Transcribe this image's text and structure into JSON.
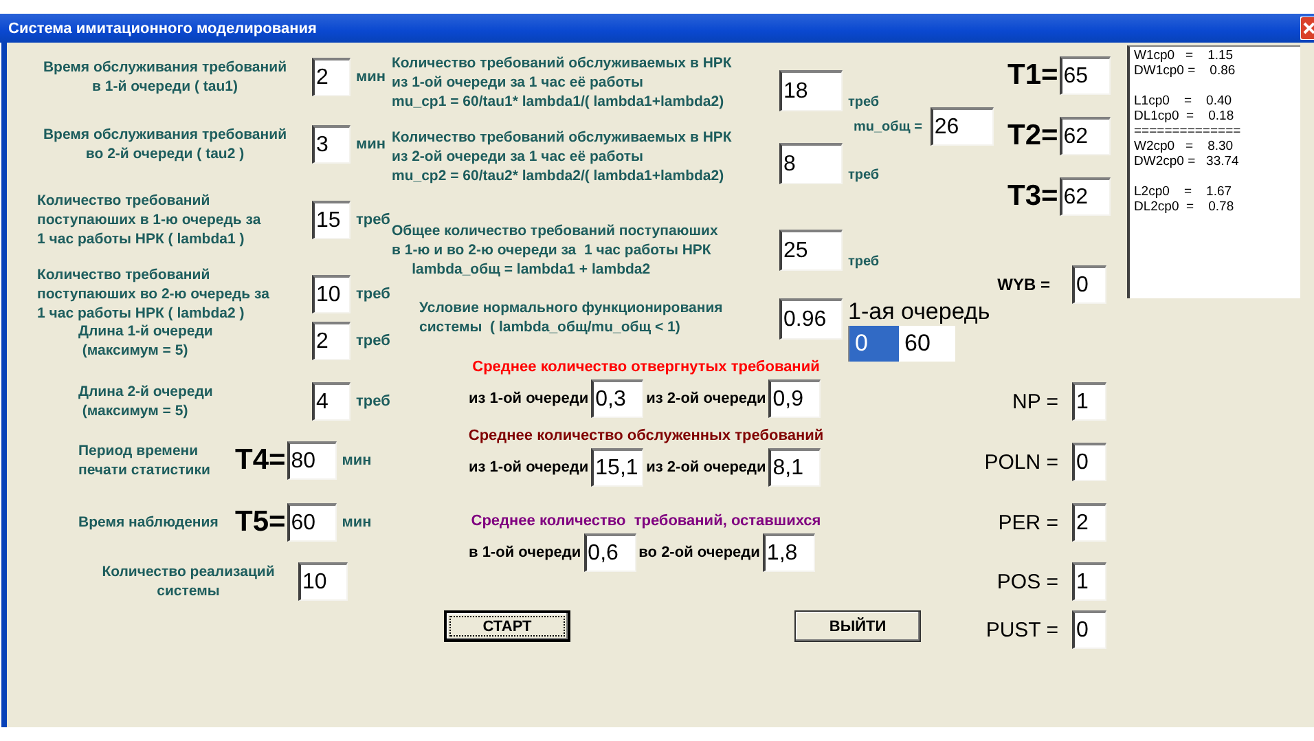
{
  "window": {
    "title": "Система имитационного моделирования"
  },
  "inputs": [
    {
      "label": "Время обслуживания требований\nв 1-й очереди ( tau1)",
      "value": "2",
      "unit": "мин"
    },
    {
      "label": "Время обслуживания требований\nво 2-й очереди ( tau2 )",
      "value": "3",
      "unit": "мин"
    },
    {
      "label": "Количество требований\nпоступаюших в 1-ю очередь за\n1 час работы НРК ( lambda1 )",
      "value": "15",
      "unit": "треб"
    },
    {
      "label": "Количество требований\nпоступаюших во 2-ю очередь за\n1 час работы НРК ( lambda2 )",
      "value": "10",
      "unit": "треб"
    },
    {
      "label": "Длина 1-й очереди\n (максимум = 5)",
      "value": "2",
      "unit": "треб"
    },
    {
      "label": "Длина 2-й очереди\n (максимум = 5)",
      "value": "4",
      "unit": "треб"
    },
    {
      "label": "Период времени\nпечати статистики",
      "prefix": "T4=",
      "value": "80",
      "unit": "мин"
    },
    {
      "label": "Время наблюдения",
      "prefix": "T5=",
      "value": "60",
      "unit": "мин"
    },
    {
      "label": "Количество реализаций\nсистемы",
      "value": "10"
    }
  ],
  "computed": [
    {
      "label": "Количество требований обслуживаемых в НРК\nиз 1-ой очереди за 1 час её работы\nmu_cp1 = 60/tau1* lambda1/( lambda1+lambda2)",
      "value": "18",
      "unit": "треб"
    },
    {
      "label": "Количество требований обслуживаемых в НРК\nиз 2-ой очереди за 1 час её работы\nmu_cp2 = 60/tau2* lambda2/( lambda1+lambda2)",
      "value": "8",
      "unit": "треб"
    },
    {
      "label": "Общее количество требований поступаюших\nв 1-ю и во 2-ю очереди за  1 час работы НРК\n     lambda_общ = lambda1 + lambda2",
      "value": "25",
      "unit": "треб"
    },
    {
      "label": "Условие нормального функционирования\nсистемы  ( lambda_общ/mu_общ < 1)",
      "value": "0.96"
    }
  ],
  "mu_total": {
    "label": "mu_общ =",
    "value": "26"
  },
  "t_fields": [
    {
      "label": "T1=",
      "value": "65"
    },
    {
      "label": "T2=",
      "value": "62"
    },
    {
      "label": "T3=",
      "value": "62"
    }
  ],
  "queue": {
    "title": "1-ая очередь",
    "cells": [
      {
        "text": "0",
        "selected": true
      },
      {
        "text": "60",
        "selected": false
      }
    ]
  },
  "stats": [
    {
      "title": "Среднее количество отвергнутых требований",
      "color": "#ff0000",
      "cells": [
        {
          "label": "из 1-ой очереди",
          "value": "0,3"
        },
        {
          "label": "из 2-ой очереди",
          "value": "0,9"
        }
      ]
    },
    {
      "title": "Среднее количество обслуженных требований",
      "color": "#800000",
      "cells": [
        {
          "label": "из 1-ой очереди",
          "value": "15,1"
        },
        {
          "label": "из 2-ой очереди",
          "value": "8,1"
        }
      ]
    },
    {
      "title": "Среднее количество  требований, оставшихся",
      "color": "#800080",
      "cells": [
        {
          "label": "в 1-ой очереди",
          "value": "0,6"
        },
        {
          "label": "во 2-ой очереди",
          "value": "1,8"
        }
      ]
    }
  ],
  "params": [
    {
      "label": "WYB =",
      "value": "0"
    },
    {
      "label": "NP =",
      "value": "1"
    },
    {
      "label": "POLN =",
      "value": "0"
    },
    {
      "label": "PER =",
      "value": "2"
    },
    {
      "label": "POS =",
      "value": "1"
    },
    {
      "label": "PUST =",
      "value": "0"
    }
  ],
  "buttons": [
    {
      "label": "СТАРТ",
      "focused": true
    },
    {
      "label": "ВЫЙТИ",
      "focused": false
    }
  ],
  "results": [
    [
      "W1cp0   =    1.15",
      "DW1cp0 =    0.86"
    ],
    [
      "L1cp0    =    0.40",
      "DL1cp0  =    0.18",
      "==============",
      "W2cp0   =    8.30",
      "DW2cp0 =   33.74"
    ],
    [
      "L2cp0    =    1.67",
      "DL2cp0  =    0.78"
    ]
  ]
}
